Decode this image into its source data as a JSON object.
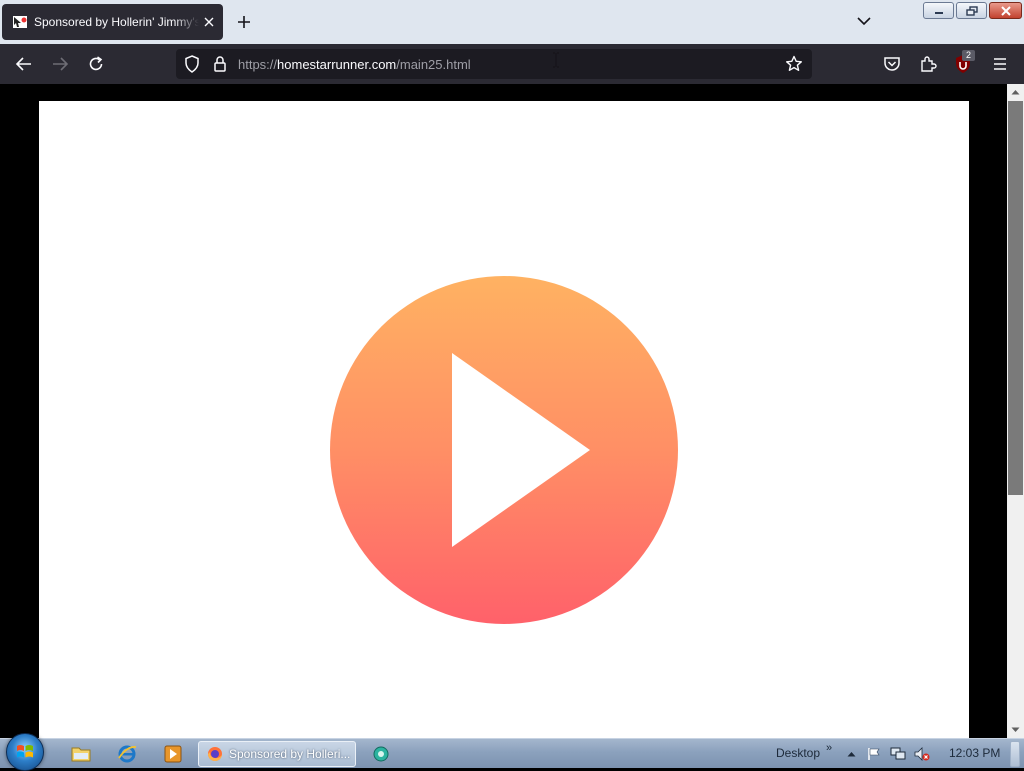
{
  "browser": {
    "tab": {
      "title": "Sponsored by Hollerin' Jimmy's"
    },
    "url": {
      "scheme": "https://",
      "host": "homestarrunner.com",
      "path": "/main25.html"
    },
    "extension_badge": "2"
  },
  "page": {
    "background": "#ffffff",
    "play_button": {
      "gradient_top": "#ffb262",
      "gradient_bottom": "#ff616a",
      "icon": "play-icon"
    }
  },
  "taskbar": {
    "active_task_label": "Sponsored by Holleri...",
    "desktop_label": "Desktop",
    "chevron": "»",
    "clock": "12:03 PM"
  }
}
